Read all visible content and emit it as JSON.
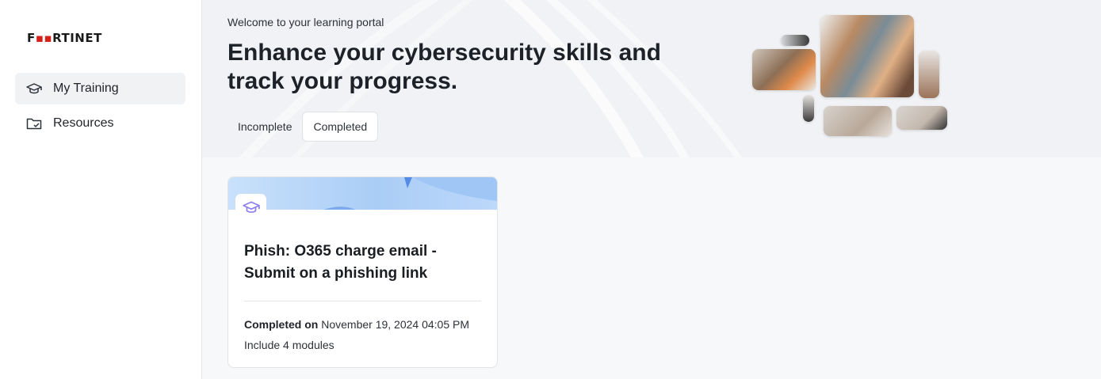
{
  "brand": {
    "logo_text": "FORTINET",
    "logo_red_glyph": "■",
    "accent_red": "#d6211b"
  },
  "sidebar": {
    "items": [
      {
        "label": "My Training",
        "icon": "graduation-cap-icon",
        "active": true
      },
      {
        "label": "Resources",
        "icon": "folder-icon",
        "active": false
      }
    ]
  },
  "hero": {
    "welcome": "Welcome to your learning portal",
    "headline": "Enhance your cybersecurity skills and track your progress.",
    "tabs": [
      {
        "label": "Incomplete",
        "selected": false
      },
      {
        "label": "Completed",
        "selected": true
      }
    ]
  },
  "cards": [
    {
      "icon": "graduation-cap-icon",
      "title": "Phish: O365 charge email - Submit on a phishing link",
      "completed_label": "Completed on",
      "completed_date": "November 19, 2024 04:05 PM",
      "modules": "Include 4 modules"
    }
  ],
  "colors": {
    "banner_blue": "#a9cdf7",
    "badge_purple": "#8b7cf0"
  }
}
